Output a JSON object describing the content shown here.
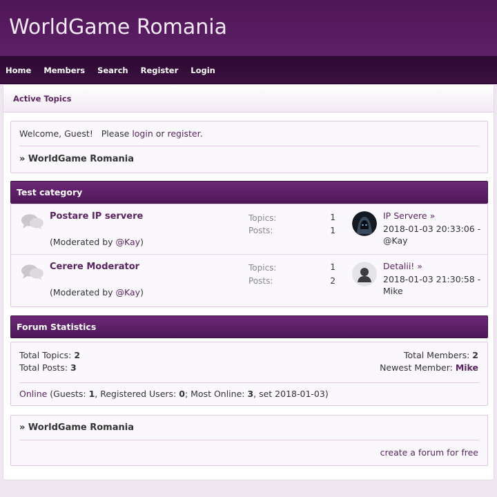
{
  "site": {
    "title": "WorldGame Romania"
  },
  "nav": [
    "Home",
    "Members",
    "Search",
    "Register",
    "Login"
  ],
  "subbar": {
    "active_topics": "Active Topics"
  },
  "welcome": {
    "prefix": "Welcome, Guest!   Please ",
    "login": "login",
    "or": " or ",
    "register": "register",
    "suffix": "."
  },
  "breadcrumb": "» WorldGame Romania",
  "category": {
    "title": "Test category",
    "forums": [
      {
        "name": "Postare IP servere",
        "mod_prefix": "(Moderated by ",
        "mod_user": "@Kay",
        "mod_suffix": ")",
        "topics_label": "Topics:",
        "topics": "1",
        "posts_label": "Posts:",
        "posts": "1",
        "last_title": "IP Servere",
        "last_arrow": "»",
        "last_date": "2018-01-03 20:33:06 -",
        "last_user": "@Kay",
        "avatar_icon": "hooded-figure-avatar"
      },
      {
        "name": "Cerere Moderator",
        "mod_prefix": "(Moderated by ",
        "mod_user": "@Kay",
        "mod_suffix": ")",
        "topics_label": "Topics:",
        "topics": "1",
        "posts_label": "Posts:",
        "posts": "2",
        "last_title": "Detalii!",
        "last_arrow": "»",
        "last_date": "2018-01-03 21:30:58 -",
        "last_user": "Mike",
        "avatar_icon": "default-user-avatar"
      }
    ]
  },
  "stats": {
    "title": "Forum Statistics",
    "total_topics_label": "Total Topics: ",
    "total_topics": "2",
    "total_posts_label": "Total Posts: ",
    "total_posts": "3",
    "total_members_label": "Total Members: ",
    "total_members": "2",
    "newest_member_label": "Newest Member: ",
    "newest_member": "Mike",
    "online_link": "Online",
    "online_guests_label": " (Guests: ",
    "online_guests": "1",
    "online_registered_label": ", Registered Users: ",
    "online_registered": "0",
    "online_most_label": "; Most Online: ",
    "online_most": "3",
    "online_suffix": ", set 2018-01-03)"
  },
  "footer": {
    "breadcrumb": "» WorldGame Romania",
    "create_link": "create a forum for free"
  },
  "colors": {
    "accent": "#5a2460",
    "header": "#4f1656",
    "navbar": "#2e0a33"
  }
}
